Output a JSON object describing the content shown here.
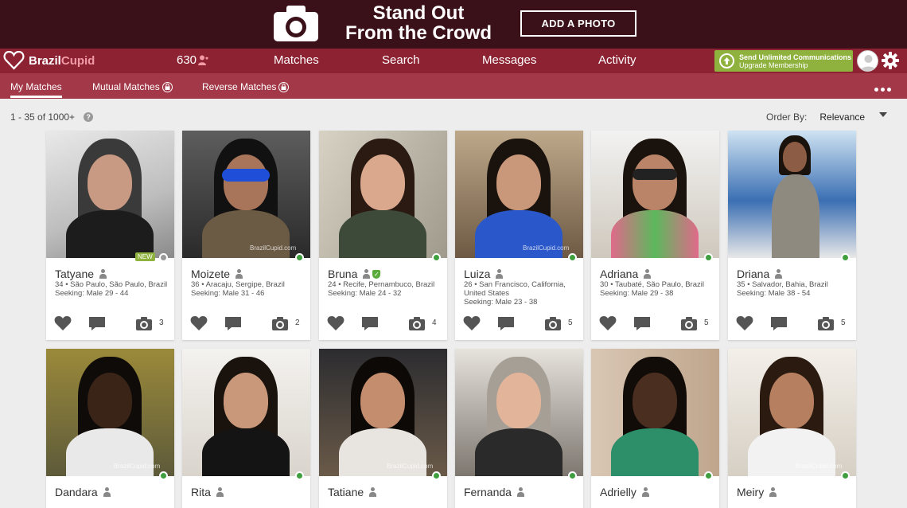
{
  "banner": {
    "headline_line1": "Stand Out",
    "headline_line2": "From the Crowd",
    "button_label": "ADD A PHOTO"
  },
  "nav": {
    "logo_prefix": "Brazil",
    "logo_suffix": "Cupid",
    "credits": "630",
    "items": [
      "Matches",
      "Search",
      "Messages",
      "Activity"
    ],
    "upgrade_title": "Send Unlimited Communications",
    "upgrade_sub": "Upgrade Membership"
  },
  "subnav": {
    "tabs": [
      "My Matches",
      "Mutual Matches",
      "Reverse Matches"
    ]
  },
  "results": {
    "count": "1 - 35 of 1000+",
    "help": "?",
    "order_label": "Order By:",
    "order_value": "Relevance"
  },
  "new_badge": "NEW",
  "profiles": [
    {
      "name": "Tatyane",
      "details": "34 • São Paulo, São Paulo, Brazil",
      "seeking": "Seeking: Male 29 - 44",
      "photos": "3",
      "online": false,
      "new": true
    },
    {
      "name": "Moizete",
      "details": "36 • Aracaju, Sergipe, Brazil",
      "seeking": "Seeking: Male 31 - 46",
      "photos": "2",
      "online": true
    },
    {
      "name": "Bruna",
      "details": "24 • Recife, Pernambuco, Brazil",
      "seeking": "Seeking: Male 24 - 32",
      "photos": "4",
      "online": true,
      "verified": true
    },
    {
      "name": "Luiza",
      "details": "26 • San Francisco, California, United States",
      "seeking": "Seeking: Male 23 - 38",
      "photos": "5",
      "online": true
    },
    {
      "name": "Adriana",
      "details": "30 • Taubaté, São Paulo, Brazil",
      "seeking": "Seeking: Male 29 - 38",
      "photos": "5",
      "online": true
    },
    {
      "name": "Driana",
      "details": "35 • Salvador, Bahia, Brazil",
      "seeking": "Seeking: Male 38 - 54",
      "photos": "5",
      "online": true
    },
    {
      "name": "Dandara",
      "online": true
    },
    {
      "name": "Rita",
      "online": true
    },
    {
      "name": "Tatiane",
      "online": true
    },
    {
      "name": "Fernanda",
      "online": true
    },
    {
      "name": "Adrielly",
      "online": true
    },
    {
      "name": "Meiry",
      "online": true
    }
  ],
  "watermark": "BrazilCupid.com",
  "colors": {
    "banner_bg": "#3a1119",
    "nav_bg": "#8c2232",
    "subnav_bg": "#a23848",
    "upgrade_green": "#8fb13d",
    "online_green": "#3f9f3f"
  }
}
